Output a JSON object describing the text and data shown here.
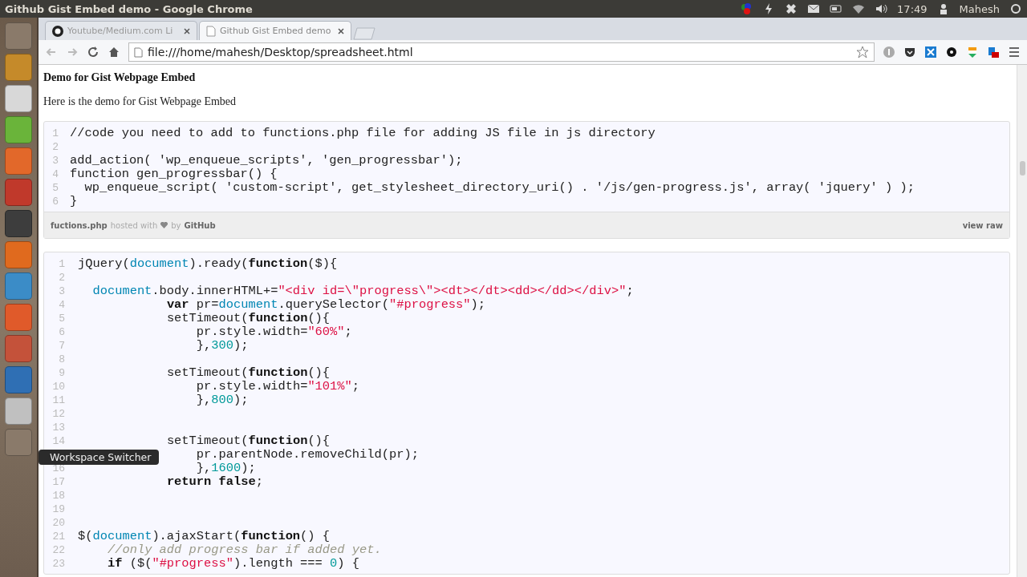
{
  "top_bar": {
    "title": "Github Gist Embed demo - Google Chrome",
    "clock": "17:49",
    "user": "Mahesh"
  },
  "tabs": [
    {
      "label": "Youtube/Medium.com Li",
      "selected": false
    },
    {
      "label": "Github Gist Embed demo",
      "selected": true
    }
  ],
  "address_bar": {
    "value": "file:///home/mahesh/Desktop/spreadsheet.html"
  },
  "page": {
    "heading": "Demo for Gist Webpage Embed",
    "intro": "Here is the demo for Gist Webpage Embed"
  },
  "gists": [
    {
      "lines": [
        {
          "number": "1",
          "tokens": [
            {
              "kind": "plain",
              "text": "//code you need to add to functions.php file for adding JS file in js directory"
            }
          ]
        },
        {
          "number": "2"
        },
        {
          "number": "3",
          "tokens": [
            {
              "kind": "plain",
              "text": "add_action( 'wp_enqueue_scripts', 'gen_progressbar');"
            }
          ]
        },
        {
          "number": "4",
          "tokens": [
            {
              "kind": "plain",
              "text": "function gen_progressbar() {"
            }
          ]
        },
        {
          "number": "5",
          "tokens": [
            {
              "kind": "plain",
              "text": "  wp_enqueue_script( 'custom-script', get_stylesheet_directory_uri() . '/js/gen-progress.js', array( 'jquery' ) );"
            }
          ]
        },
        {
          "number": "6",
          "tokens": [
            {
              "kind": "plain",
              "text": "}"
            }
          ]
        }
      ],
      "footer": {
        "file": "fuctions.php",
        "hosted": "hosted with",
        "by": "by",
        "github": "GitHub",
        "raw": "view raw"
      }
    },
    {
      "lines": [
        {
          "number": "1",
          "tokens": [
            {
              "kind": "plain",
              "text": "jQuery("
            },
            {
              "kind": "builtin",
              "text": "document"
            },
            {
              "kind": "plain",
              "text": ").ready("
            },
            {
              "kind": "keyword",
              "text": "function"
            },
            {
              "kind": "plain",
              "text": "($){"
            }
          ]
        },
        {
          "number": "2"
        },
        {
          "number": "3",
          "tokens": [
            {
              "kind": "builtin",
              "text": "  document"
            },
            {
              "kind": "plain",
              "text": ".body.innerHTML+="
            },
            {
              "kind": "string",
              "text": "\"<div id=\\\"progress\\\"><dt></dt><dd></dd></div>\""
            },
            {
              "kind": "plain",
              "text": ";"
            }
          ]
        },
        {
          "number": "4",
          "tokens": [
            {
              "kind": "keyword",
              "text": "            var"
            },
            {
              "kind": "plain",
              "text": " pr="
            },
            {
              "kind": "builtin",
              "text": "document"
            },
            {
              "kind": "plain",
              "text": ".querySelector("
            },
            {
              "kind": "string",
              "text": "\"#progress\""
            },
            {
              "kind": "plain",
              "text": ");"
            }
          ]
        },
        {
          "number": "5",
          "tokens": [
            {
              "kind": "plain",
              "text": "            setTimeout("
            },
            {
              "kind": "keyword",
              "text": "function"
            },
            {
              "kind": "plain",
              "text": "(){"
            }
          ]
        },
        {
          "number": "6",
          "tokens": [
            {
              "kind": "plain",
              "text": "                pr.style.width="
            },
            {
              "kind": "string",
              "text": "\"60%\""
            },
            {
              "kind": "plain",
              "text": ";"
            }
          ]
        },
        {
          "number": "7",
          "tokens": [
            {
              "kind": "plain",
              "text": "                },"
            },
            {
              "kind": "number",
              "text": "300"
            },
            {
              "kind": "plain",
              "text": ");"
            }
          ]
        },
        {
          "number": "8"
        },
        {
          "number": "9",
          "tokens": [
            {
              "kind": "plain",
              "text": "            setTimeout("
            },
            {
              "kind": "keyword",
              "text": "function"
            },
            {
              "kind": "plain",
              "text": "(){"
            }
          ]
        },
        {
          "number": "10",
          "tokens": [
            {
              "kind": "plain",
              "text": "                pr.style.width="
            },
            {
              "kind": "string",
              "text": "\"101%\""
            },
            {
              "kind": "plain",
              "text": ";"
            }
          ]
        },
        {
          "number": "11",
          "tokens": [
            {
              "kind": "plain",
              "text": "                },"
            },
            {
              "kind": "number",
              "text": "800"
            },
            {
              "kind": "plain",
              "text": ");"
            }
          ]
        },
        {
          "number": "12"
        },
        {
          "number": "13"
        },
        {
          "number": "14",
          "tokens": [
            {
              "kind": "plain",
              "text": "            setTimeout("
            },
            {
              "kind": "keyword",
              "text": "function"
            },
            {
              "kind": "plain",
              "text": "(){"
            }
          ]
        },
        {
          "tokens": [
            {
              "kind": "plain",
              "text": "                pr.parentNode.removeChild(pr);"
            }
          ]
        },
        {
          "number": "16",
          "tokens": [
            {
              "kind": "plain",
              "text": "                },"
            },
            {
              "kind": "number",
              "text": "1600"
            },
            {
              "kind": "plain",
              "text": ");"
            }
          ]
        },
        {
          "number": "17",
          "tokens": [
            {
              "kind": "keyword",
              "text": "            return false"
            },
            {
              "kind": "plain",
              "text": ";"
            }
          ]
        },
        {
          "number": "18"
        },
        {
          "number": "19"
        },
        {
          "number": "20"
        },
        {
          "number": "21",
          "tokens": [
            {
              "kind": "plain",
              "text": "$("
            },
            {
              "kind": "builtin",
              "text": "document"
            },
            {
              "kind": "plain",
              "text": ").ajaxStart("
            },
            {
              "kind": "keyword",
              "text": "function"
            },
            {
              "kind": "plain",
              "text": "() {"
            }
          ]
        },
        {
          "number": "22",
          "tokens": [
            {
              "kind": "comment",
              "text": "    //only add progress bar if added yet."
            }
          ]
        },
        {
          "number": "23",
          "tokens": [
            {
              "kind": "keyword",
              "text": "    if"
            },
            {
              "kind": "plain",
              "text": " ($("
            },
            {
              "kind": "string",
              "text": "\"#progress\""
            },
            {
              "kind": "plain",
              "text": ").length === "
            },
            {
              "kind": "number",
              "text": "0"
            },
            {
              "kind": "plain",
              "text": ") {"
            }
          ]
        }
      ]
    }
  ],
  "tooltip": {
    "text": "Workspace Switcher"
  }
}
